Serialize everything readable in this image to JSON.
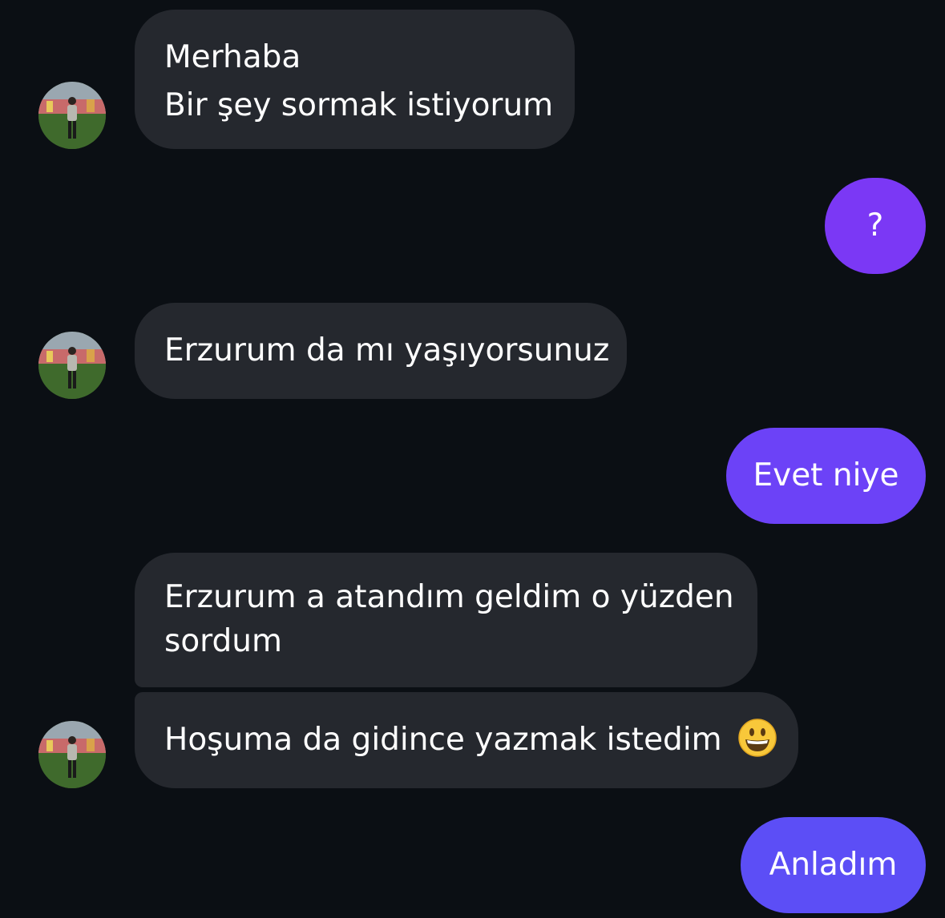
{
  "colors": {
    "background": "#0b0f14",
    "incoming_bubble": "#25282e",
    "outgoing_bubble_1": "#7b38f5",
    "outgoing_bubble_2": "#6c42f7",
    "outgoing_bubble_3": "#5c4ef6",
    "text": "#ffffff"
  },
  "messages": [
    {
      "from": "other",
      "lines": [
        "Merhaba",
        "Bir şey sormak istiyorum"
      ],
      "avatar": "profile-photo"
    },
    {
      "from": "me",
      "text": "?"
    },
    {
      "from": "other",
      "text": "Erzurum da mı yaşıyorsunuz",
      "avatar": "profile-photo"
    },
    {
      "from": "me",
      "text": "Evet niye"
    },
    {
      "from": "other",
      "lines": [
        "Erzurum a atandım geldim o yüzden",
        "sordum"
      ]
    },
    {
      "from": "other",
      "text": "Hoşuma da gidince yazmak istedim",
      "emoji": "grinning-face-icon",
      "avatar": "profile-photo"
    },
    {
      "from": "me",
      "text": "Anladım"
    }
  ]
}
